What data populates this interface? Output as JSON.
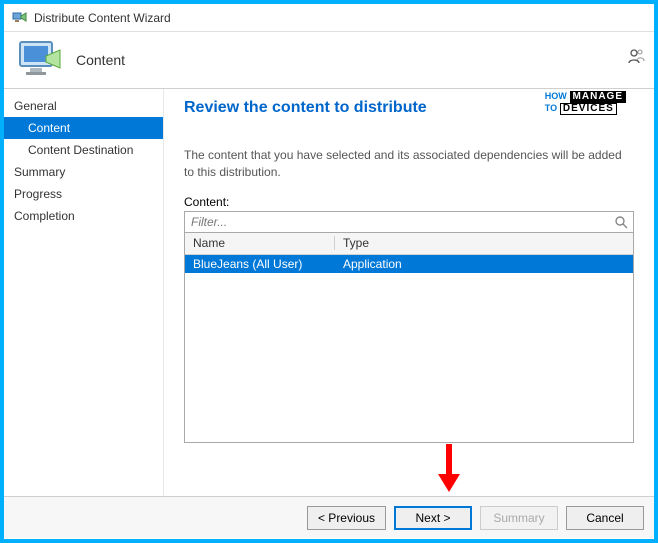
{
  "window": {
    "title": "Distribute Content Wizard"
  },
  "header": {
    "title": "Content"
  },
  "sidebar": {
    "items": [
      {
        "label": "General",
        "type": "top"
      },
      {
        "label": "Content",
        "type": "sub",
        "selected": true
      },
      {
        "label": "Content Destination",
        "type": "sub"
      },
      {
        "label": "Summary",
        "type": "top"
      },
      {
        "label": "Progress",
        "type": "top"
      },
      {
        "label": "Completion",
        "type": "top"
      }
    ]
  },
  "content": {
    "heading": "Review the content to distribute",
    "description": "The content that you have selected and its associated dependencies will be added to this distribution.",
    "list_label": "Content:",
    "filter_placeholder": "Filter...",
    "columns": {
      "name": "Name",
      "type": "Type"
    },
    "rows": [
      {
        "name": "BlueJeans (All User)",
        "type": "Application"
      }
    ]
  },
  "footer": {
    "previous": "< Previous",
    "next": "Next >",
    "summary": "Summary",
    "cancel": "Cancel"
  },
  "watermark": {
    "how": "HOW",
    "to": "TO",
    "manage": "MANAGE",
    "devices": "DEVICES"
  }
}
